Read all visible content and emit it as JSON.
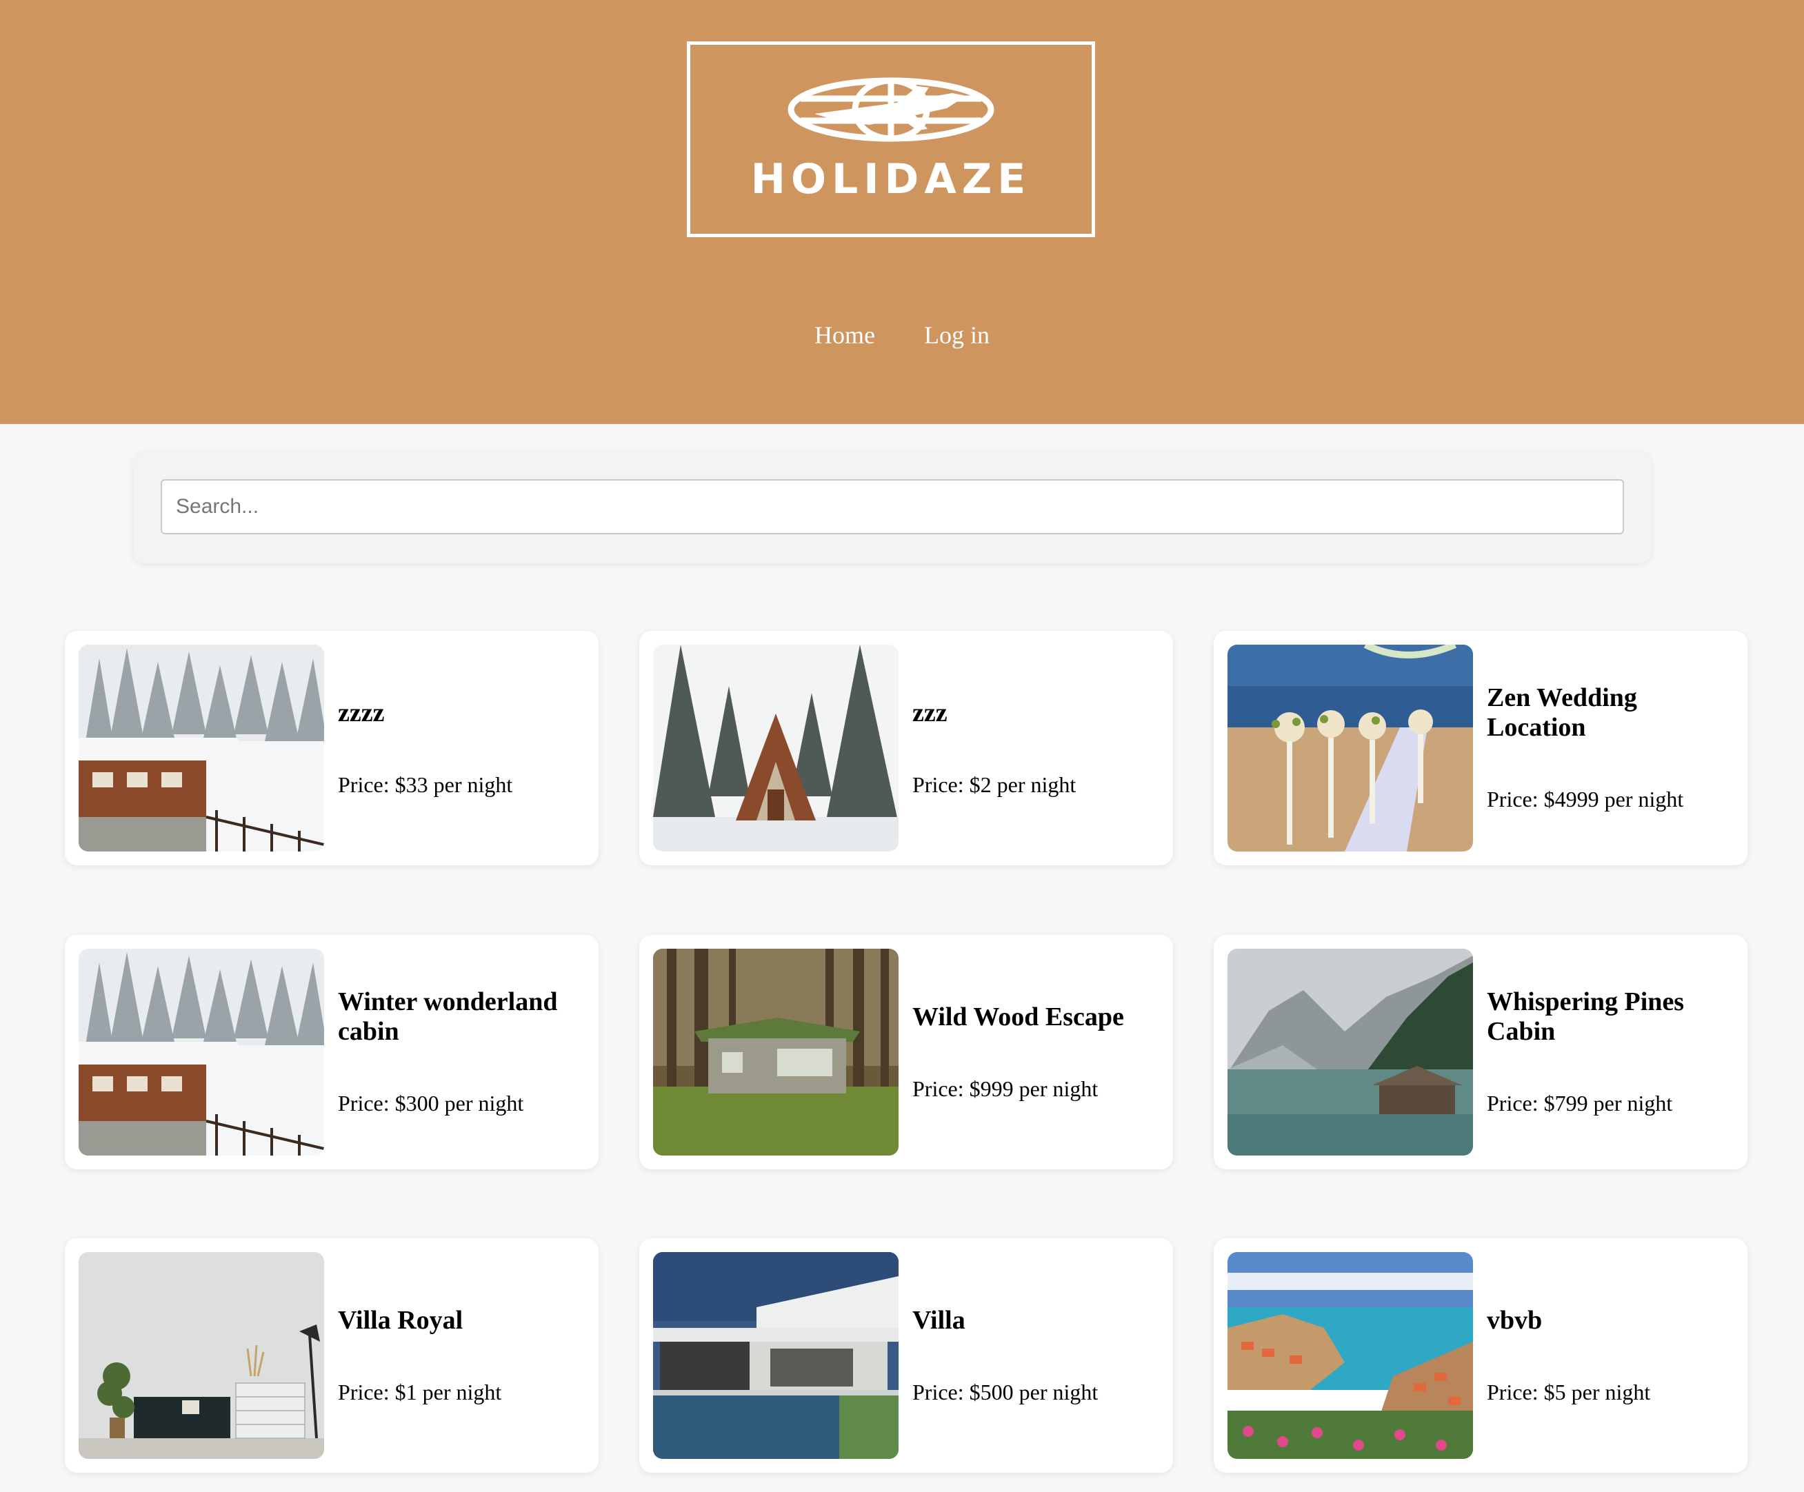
{
  "header": {
    "brand": "HOLIDAZE",
    "background": "#cf955f",
    "nav": [
      {
        "label": "Home"
      },
      {
        "label": "Log in"
      }
    ]
  },
  "search": {
    "placeholder": "Search...",
    "value": ""
  },
  "price_prefix": "Price:",
  "price_suffix": "per night",
  "venues": [
    {
      "name": "zzzz",
      "price": "Price: $33 per night",
      "image": "snowy-chalet"
    },
    {
      "name": "zzz",
      "price": "Price: $2 per night",
      "image": "a-frame-cabin-snow"
    },
    {
      "name": "Zen Wedding Location",
      "price": "Price: $4999 per night",
      "image": "beach-wedding"
    },
    {
      "name": "Winter wonderland cabin",
      "price": "Price: $300 per night",
      "image": "snowy-chalet"
    },
    {
      "name": "Wild Wood Escape",
      "price": "Price: $999 per night",
      "image": "forest-cabin"
    },
    {
      "name": "Whispering Pines Cabin",
      "price": "Price: $799 per night",
      "image": "mountain-lake-cabin"
    },
    {
      "name": "Villa Royal",
      "price": "Price: $1 per night",
      "image": "interior-room"
    },
    {
      "name": "Villa",
      "price": "Price: $500 per night",
      "image": "modern-villa-pool"
    },
    {
      "name": "vbvb",
      "price": "Price: $5 per night",
      "image": "coastal-town"
    }
  ]
}
